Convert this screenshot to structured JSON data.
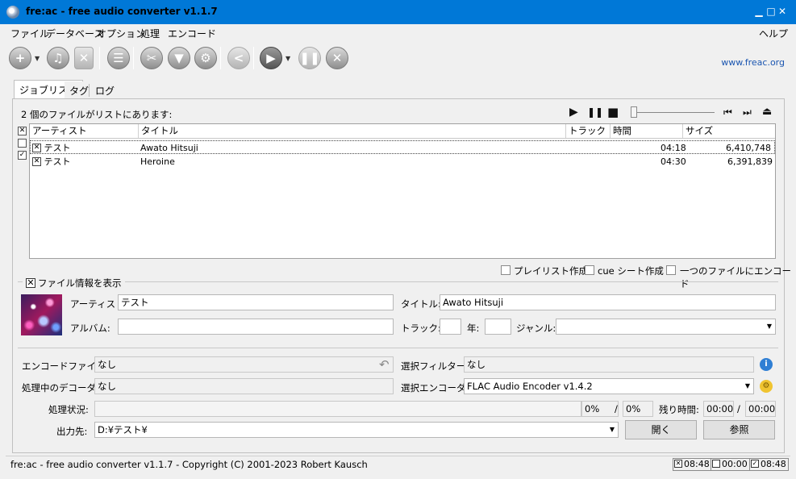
{
  "window": {
    "title": "fre:ac - free audio converter v1.1.7",
    "minimize": "▁",
    "maximize": "□",
    "close": "✕"
  },
  "menu": [
    "ファイル",
    "データベース",
    "オプション",
    "処理",
    "エンコード"
  ],
  "help_menu": "ヘルプ",
  "website": "www.freac.org",
  "tabs": [
    "ジョブリスト",
    "タグ",
    "ログ"
  ],
  "joblist": {
    "count_text": "2 個のファイルがリストにあります:",
    "columns": [
      "アーティスト",
      "タイトル",
      "トラック",
      "時間",
      "サイズ"
    ],
    "rows": [
      {
        "checked": true,
        "artist": "テスト",
        "title": "Awato Hitsuji",
        "track": "",
        "time": "04:18",
        "size": "6,410,748"
      },
      {
        "checked": true,
        "artist": "テスト",
        "title": "Heroine",
        "track": "",
        "time": "04:30",
        "size": "6,391,839"
      }
    ],
    "seek_position": 0
  },
  "options": {
    "playlist": "プレイリスト作成",
    "cue_sheet": "cue シート作成",
    "single_file": "一つのファイルにエンコード"
  },
  "file_info": {
    "toggle_label": "ファイル情報を表示",
    "artist_label": "アーティスト:",
    "artist_value": "テスト",
    "title_label": "タイトル:",
    "title_value": "Awato Hitsuji",
    "album_label": "アルバム:",
    "album_value": "",
    "track_label": "トラック:",
    "track_value": "",
    "year_label": "年:",
    "year_value": "",
    "genre_label": "ジャンル:",
    "genre_value": ""
  },
  "encode": {
    "encode_file_label": "エンコードファイル:",
    "encode_file_value": "なし",
    "filter_label": "選択フィルター:",
    "filter_value": "なし",
    "decoder_label": "処理中のデコーダ:",
    "decoder_value": "なし",
    "encoder_label": "選択エンコーダ:",
    "encoder_value": "FLAC Audio Encoder v1.4.2",
    "progress_label": "処理状況:",
    "progress_percent": 0,
    "percent_file": "0%",
    "slash": "/",
    "percent_total": "0%",
    "remaining_label": "残り時間:",
    "remaining_file": "00:00",
    "remaining_total": "00:00",
    "output_label": "出力先:",
    "output_value": "D:¥テスト¥",
    "open_button": "開く",
    "browse_button": "参照"
  },
  "status": {
    "text": "fre:ac - free audio converter v1.1.7 - Copyright (C) 2001-2023 Robert Kausch",
    "boxes": [
      {
        "checked": true,
        "time": "08:48"
      },
      {
        "checked": false,
        "time": "00:00"
      },
      {
        "checked": true,
        "time": "08:48"
      }
    ]
  }
}
